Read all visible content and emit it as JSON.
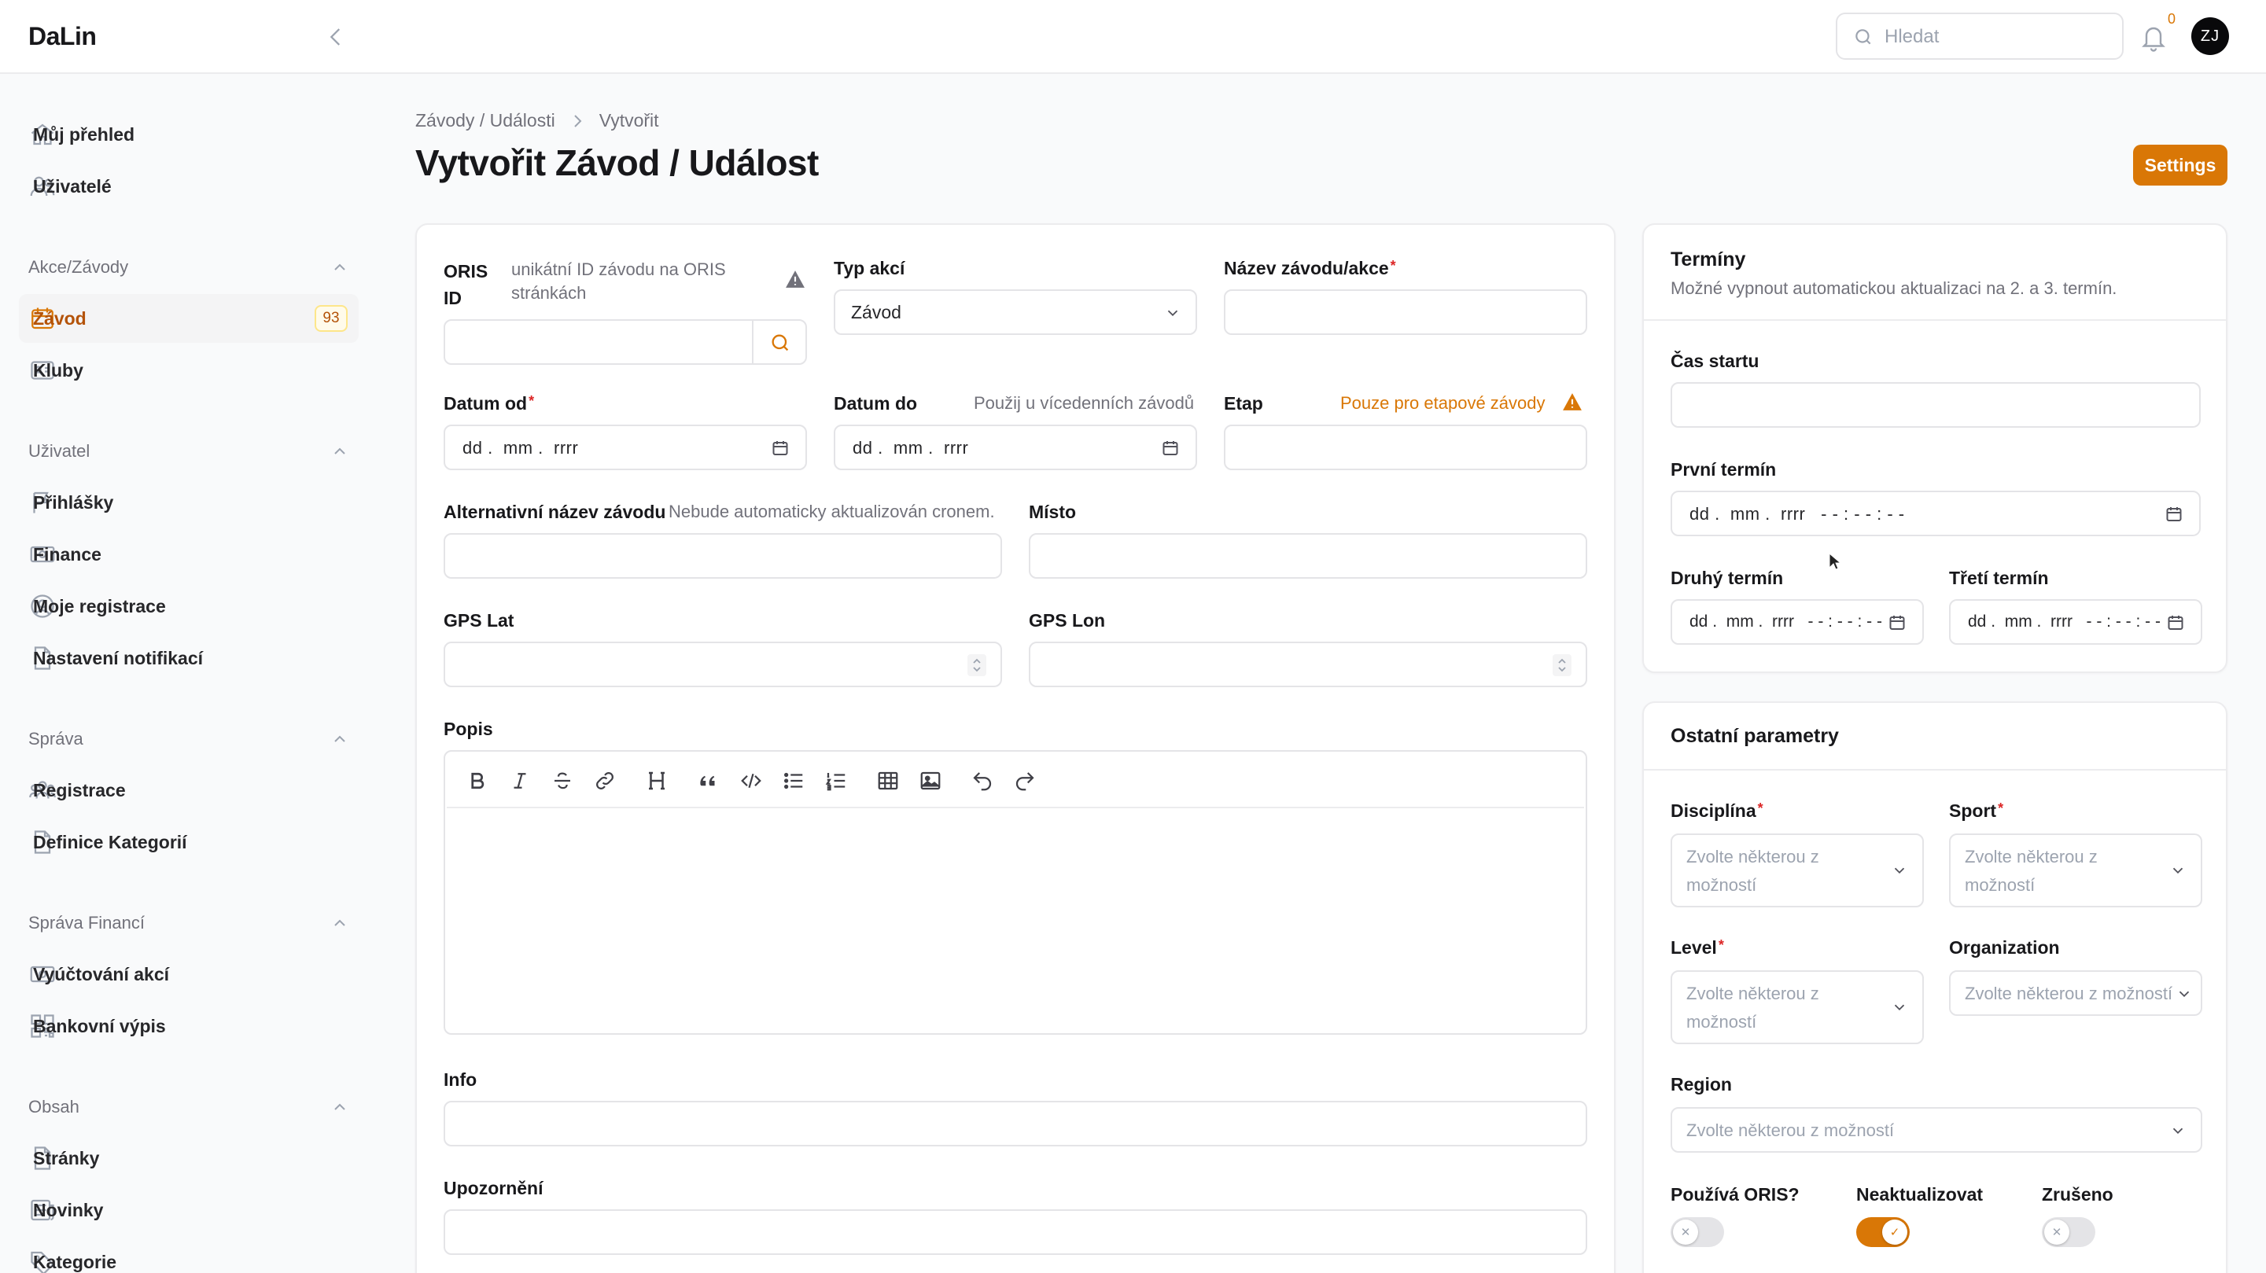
{
  "app": {
    "brand": "DaLin"
  },
  "header": {
    "search_placeholder": "Hledat",
    "notifications_count": "0",
    "avatar_initials": "ZJ"
  },
  "sidebar": {
    "top_items": [
      {
        "label": "Můj přehled",
        "icon": "home-icon"
      },
      {
        "label": "Uživatelé",
        "icon": "users-icon"
      }
    ],
    "groups": [
      {
        "label": "Akce/Závody",
        "items": [
          {
            "label": "Závod",
            "icon": "calendar-icon",
            "active": true,
            "count": "93"
          },
          {
            "label": "Kluby",
            "icon": "id-card-icon"
          }
        ]
      },
      {
        "label": "Uživatel",
        "items": [
          {
            "label": "Přihlášky",
            "icon": "flag-icon"
          },
          {
            "label": "Finance",
            "icon": "banknote-icon"
          },
          {
            "label": "Moje registrace",
            "icon": "user-circle-icon"
          },
          {
            "label": "Nastavení notifikací",
            "icon": "document-icon"
          }
        ]
      },
      {
        "label": "Správa",
        "items": [
          {
            "label": "Registrace",
            "icon": "user-group-icon"
          },
          {
            "label": "Definice Kategorií",
            "icon": "document-icon"
          }
        ]
      },
      {
        "label": "Správa Financí",
        "items": [
          {
            "label": "Vyúčtování akcí",
            "icon": "banknote-icon"
          },
          {
            "label": "Bankovní výpis",
            "icon": "qr-code-icon"
          }
        ]
      },
      {
        "label": "Obsah",
        "items": [
          {
            "label": "Stránky",
            "icon": "document-icon"
          },
          {
            "label": "Novinky",
            "icon": "newspaper-icon"
          },
          {
            "label": "Kategorie",
            "icon": "tag-icon"
          }
        ]
      }
    ]
  },
  "breadcrumb": {
    "parent": "Závody / Události",
    "current": "Vytvořit"
  },
  "page": {
    "title": "Vytvořit Závod / Událost",
    "settings_button": "Settings"
  },
  "form": {
    "oris_id": {
      "label_line1": "ORIS",
      "label_line2": "ID",
      "hint_line1": "unikátní ID závodu na ORIS",
      "hint_line2": "stránkách",
      "value": ""
    },
    "typ_akci": {
      "label": "Typ akcí",
      "value": "Závod"
    },
    "nazev": {
      "label": "Název závodu/akce",
      "required": "*",
      "value": ""
    },
    "datum_od": {
      "label": "Datum od",
      "required": "*",
      "placeholder": "dd .  mm .  rrrr"
    },
    "datum_do": {
      "label": "Datum do",
      "hint": "Použij u vícedenních závodů",
      "placeholder": "dd .  mm .  rrrr"
    },
    "etap": {
      "label": "Etap",
      "hint": "Pouze pro etapové závody",
      "value": ""
    },
    "alt_nazev": {
      "label": "Alternativní název závodu",
      "hint": "Nebude automaticky aktualizován cronem.",
      "value": ""
    },
    "misto": {
      "label": "Místo",
      "value": ""
    },
    "gps_lat": {
      "label": "GPS Lat",
      "value": ""
    },
    "gps_lon": {
      "label": "GPS Lon",
      "value": ""
    },
    "popis": {
      "label": "Popis",
      "toolbar": [
        "bold-icon",
        "italic-icon",
        "strikethrough-icon",
        "link-icon",
        "heading-icon",
        "blockquote-icon",
        "code-icon",
        "bullet-list-icon",
        "ordered-list-icon",
        "table-icon",
        "image-icon",
        "undo-icon",
        "redo-icon"
      ]
    },
    "info": {
      "label": "Info",
      "value": ""
    },
    "upozorneni": {
      "label": "Upozornění",
      "value": ""
    }
  },
  "terminy": {
    "title": "Termíny",
    "subtitle": "Možné vypnout automatickou aktualizaci na 2. a 3. termín.",
    "cas_startu": {
      "label": "Čas startu",
      "value": ""
    },
    "prvni": {
      "label": "První termín",
      "placeholder": "dd .  mm .  rrrr   - - : - - : - -"
    },
    "druhy": {
      "label": "Druhý termín",
      "placeholder": "dd .  mm .  rrrr   - - : - - : - -"
    },
    "treti": {
      "label": "Třetí termín",
      "placeholder": "dd .  mm .  rrrr   - - : - - : - -"
    }
  },
  "ostatni": {
    "title": "Ostatní parametry",
    "select_placeholder": "Zvolte některou z možností",
    "disciplina": {
      "label": "Disciplína",
      "required": "*"
    },
    "sport": {
      "label": "Sport",
      "required": "*"
    },
    "level": {
      "label": "Level",
      "required": "*"
    },
    "organization": {
      "label": "Organization"
    },
    "region": {
      "label": "Region"
    },
    "toggles": [
      {
        "label": "Používá ORIS?",
        "on": false
      },
      {
        "label": "Neaktualizovat",
        "on": true
      },
      {
        "label": "Zrušeno",
        "on": false
      }
    ]
  },
  "colors": {
    "accent": "#d97706",
    "required": "#dc2626"
  }
}
